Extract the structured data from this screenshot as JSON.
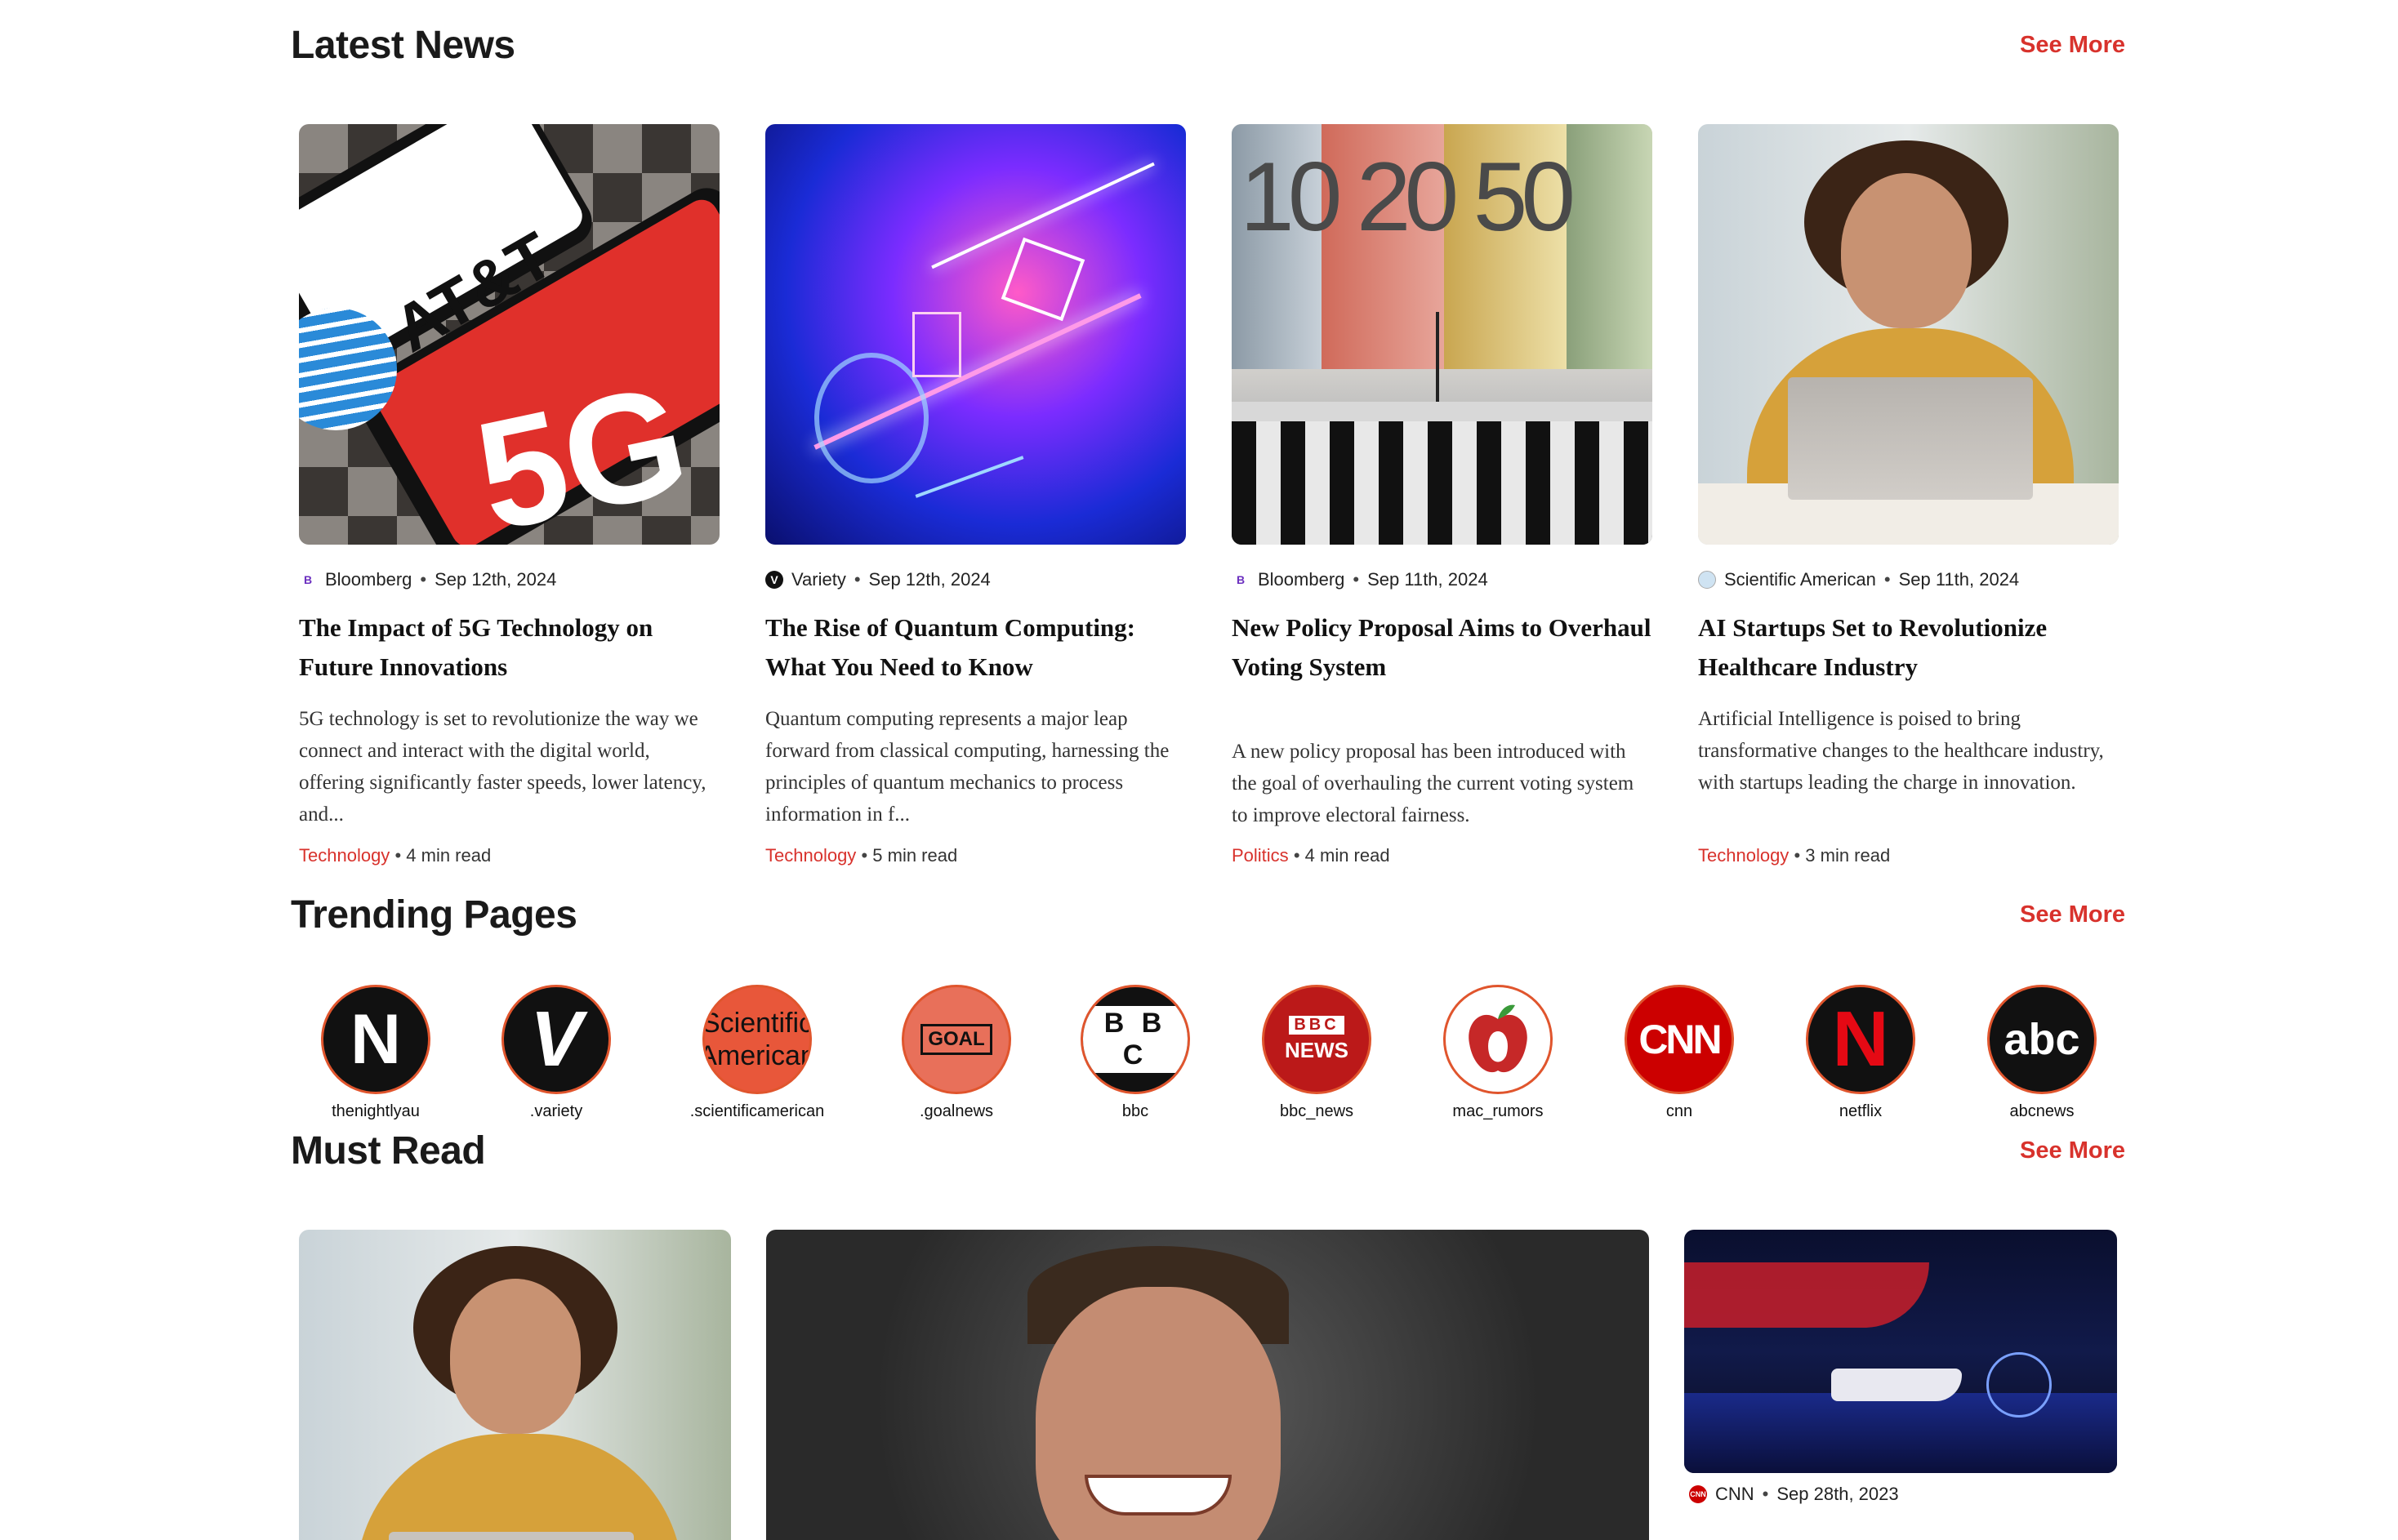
{
  "latest": {
    "title": "Latest News",
    "see_more": "See More",
    "cards": [
      {
        "source": "Bloomberg",
        "date": "Sep 12th, 2024",
        "title": "The Impact of 5G Technology on Future Innovations",
        "desc": "5G technology is set to revolutionize the way we connect and interact with the digital world, offering significantly faster speeds, lower latency, and...",
        "category": "Technology",
        "read": "4 min read",
        "img_brand": "AT&T",
        "img_text": "5G"
      },
      {
        "source": "Variety",
        "date": "Sep 12th, 2024",
        "title": "The Rise of Quantum Computing: What You Need to Know",
        "desc": "Quantum computing represents a major leap forward from classical computing, harnessing the principles of quantum mechanics to process information in f...",
        "category": "Technology",
        "read": "5 min read"
      },
      {
        "source": "Bloomberg",
        "date": "Sep 11th, 2024",
        "title": "New Policy Proposal Aims to Overhaul Voting System",
        "desc": "A new policy proposal has been introduced with the goal of overhauling the current voting system to improve electoral fairness.",
        "category": "Politics",
        "read": "4 min read",
        "img_text": "10 20 50"
      },
      {
        "source": "Scientific American",
        "date": "Sep 11th, 2024",
        "title": "AI Startups Set to Revolutionize Healthcare Industry",
        "desc": "Artificial Intelligence is poised to bring transformative changes to the healthcare industry, with startups leading the charge in innovation.",
        "category": "Technology",
        "read": "3 min read"
      }
    ]
  },
  "trending": {
    "title": "Trending Pages",
    "see_more": "See More",
    "pages": [
      {
        "label": "thenightlyau",
        "logo": "N"
      },
      {
        "label": ".variety",
        "logo": "V"
      },
      {
        "label": ".scientificamerican",
        "logo": "Scientific American"
      },
      {
        "label": ".goalnews",
        "logo": "GOAL"
      },
      {
        "label": "bbc",
        "logo": "B B C"
      },
      {
        "label": "bbc_news",
        "logo_top": "BBC",
        "logo_bottom": "NEWS"
      },
      {
        "label": "mac_rumors",
        "logo": ""
      },
      {
        "label": "cnn",
        "logo": "CNN"
      },
      {
        "label": "netflix",
        "logo": "N"
      },
      {
        "label": "abcnews",
        "logo": "abc"
      }
    ]
  },
  "must_read": {
    "title": "Must Read",
    "see_more": "See More",
    "side_source": "CNN",
    "side_date": "Sep 28th, 2023"
  },
  "colors": {
    "accent": "#d8322c"
  }
}
